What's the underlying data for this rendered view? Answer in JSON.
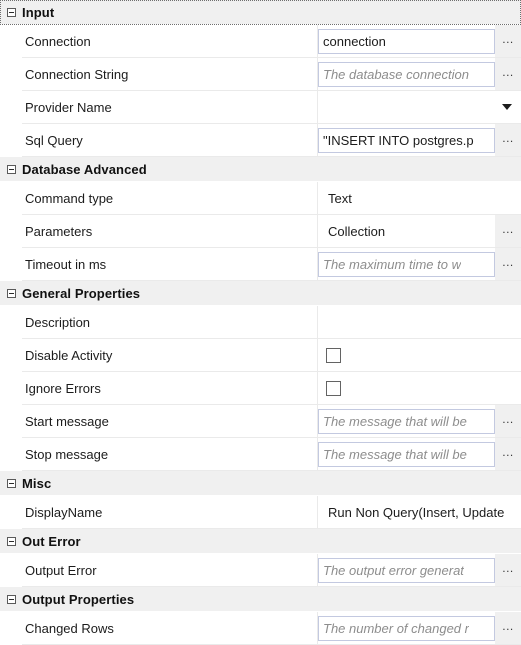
{
  "panel": {
    "name": "properties-panel"
  },
  "sections": [
    {
      "id": "input",
      "title": "Input",
      "focused": true,
      "expander_icon": "collapse-minus-icon",
      "rows": [
        {
          "label": "Connection",
          "kind": "textbox",
          "value": "connection",
          "placeholder": "",
          "is_placeholder": false,
          "ellipsis": "...",
          "has_ellipsis": true
        },
        {
          "label": "Connection String",
          "kind": "textbox",
          "value": "",
          "placeholder": "The database connection",
          "is_placeholder": true,
          "ellipsis": "...",
          "has_ellipsis": true
        },
        {
          "label": "Provider Name",
          "kind": "combobox",
          "value": "",
          "placeholder": "",
          "is_placeholder": false,
          "caret_icon": "chevron-down-icon",
          "has_ellipsis": false
        },
        {
          "label": "Sql Query",
          "kind": "textbox",
          "value": "\"INSERT INTO postgres.p",
          "placeholder": "",
          "is_placeholder": false,
          "ellipsis": "...",
          "has_ellipsis": true
        }
      ]
    },
    {
      "id": "database-advanced",
      "title": "Database Advanced",
      "focused": false,
      "expander_icon": "collapse-minus-icon",
      "rows": [
        {
          "label": "Command type",
          "kind": "plain",
          "value": "Text",
          "placeholder": "",
          "is_placeholder": false,
          "has_ellipsis": false
        },
        {
          "label": "Parameters",
          "kind": "plain",
          "value": "Collection",
          "placeholder": "",
          "is_placeholder": false,
          "ellipsis": "...",
          "has_ellipsis": true
        },
        {
          "label": "Timeout in ms",
          "kind": "textbox",
          "value": "",
          "placeholder": "The maximum time to w",
          "is_placeholder": true,
          "ellipsis": "...",
          "has_ellipsis": true
        }
      ]
    },
    {
      "id": "general-properties",
      "title": "General Properties",
      "focused": false,
      "expander_icon": "collapse-minus-icon",
      "rows": [
        {
          "label": "Description",
          "kind": "empty",
          "value": "",
          "placeholder": "",
          "is_placeholder": false,
          "has_ellipsis": false
        },
        {
          "label": "Disable Activity",
          "kind": "checkbox",
          "checked": false,
          "value": "",
          "placeholder": "",
          "is_placeholder": false,
          "has_ellipsis": false
        },
        {
          "label": "Ignore Errors",
          "kind": "checkbox",
          "checked": false,
          "value": "",
          "placeholder": "",
          "is_placeholder": false,
          "has_ellipsis": false
        },
        {
          "label": "Start message",
          "kind": "textbox",
          "value": "",
          "placeholder": "The message that will be",
          "is_placeholder": true,
          "ellipsis": "...",
          "has_ellipsis": true
        },
        {
          "label": "Stop message",
          "kind": "textbox",
          "value": "",
          "placeholder": "The message that will be",
          "is_placeholder": true,
          "ellipsis": "...",
          "has_ellipsis": true
        }
      ]
    },
    {
      "id": "misc",
      "title": "Misc",
      "focused": false,
      "expander_icon": "collapse-minus-icon",
      "rows": [
        {
          "label": "DisplayName",
          "kind": "plain",
          "value": "Run Non Query(Insert, Update",
          "placeholder": "",
          "is_placeholder": false,
          "has_ellipsis": false
        }
      ]
    },
    {
      "id": "out-error",
      "title": "Out Error",
      "focused": false,
      "expander_icon": "collapse-minus-icon",
      "rows": [
        {
          "label": "Output Error",
          "kind": "textbox",
          "value": "",
          "placeholder": "The output error generat",
          "is_placeholder": true,
          "ellipsis": "...",
          "has_ellipsis": true
        }
      ]
    },
    {
      "id": "output-properties",
      "title": "Output Properties",
      "focused": false,
      "expander_icon": "collapse-minus-icon",
      "rows": [
        {
          "label": "Changed Rows",
          "kind": "textbox",
          "value": "",
          "placeholder": "The number of changed r",
          "is_placeholder": true,
          "ellipsis": "...",
          "has_ellipsis": true
        }
      ]
    }
  ],
  "colors": {
    "section_bg": "#f0f0f0",
    "row_bg": "#ffffff",
    "grid_line": "#eaeaea",
    "field_border": "#c3c9e0",
    "placeholder_text": "#8d8d8d",
    "text": "#1c1c1c",
    "ellipsis_bg": "#f0f0f0",
    "checkbox_border": "#636363"
  }
}
